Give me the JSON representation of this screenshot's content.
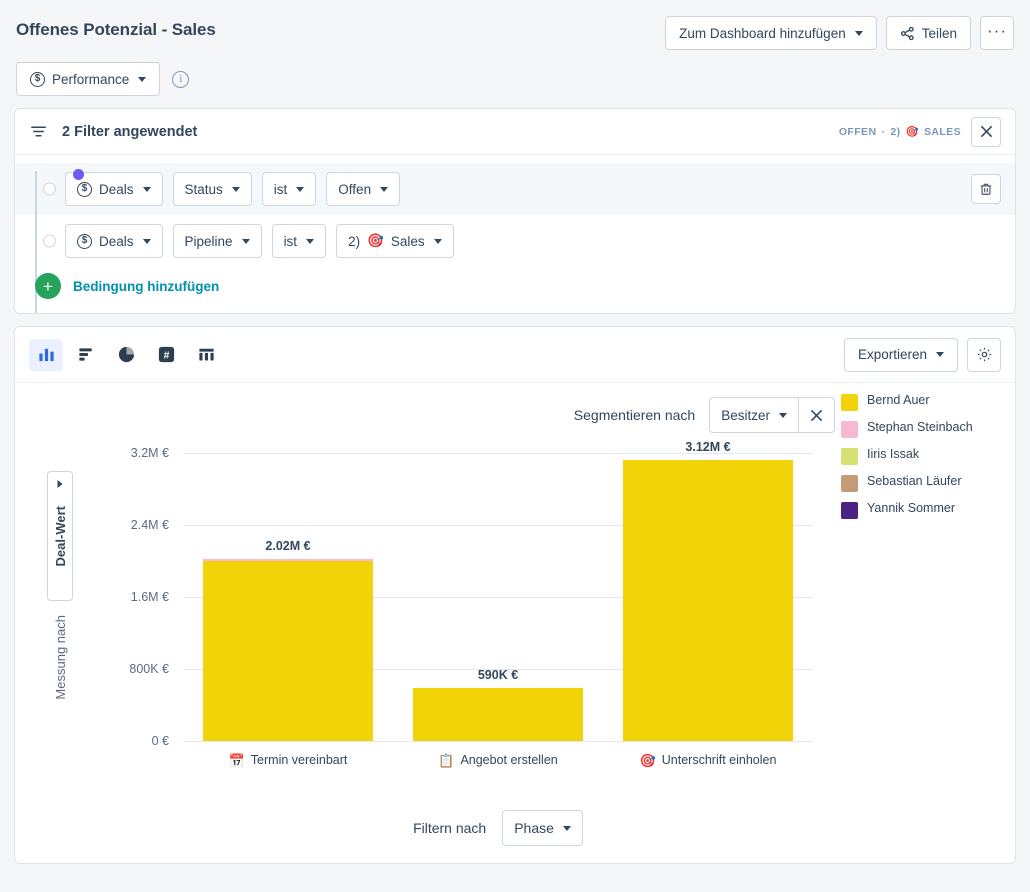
{
  "header": {
    "title": "Offenes Potenzial - Sales",
    "add_to_dashboard_label": "Zum Dashboard hinzufügen",
    "share_label": "Teilen",
    "more_label": "···"
  },
  "subheader": {
    "performance_label": "Performance",
    "currency_icon": "dollar-circle-icon",
    "info_icon": "info-icon"
  },
  "filters": {
    "title": "2 Filter angewendet",
    "applied_summary_prefix": "OFFEN",
    "applied_summary_separator": "·",
    "applied_summary_suffix": "2)",
    "applied_summary_target_icon": "🎯",
    "applied_summary_last": "SALES",
    "close_label": "✕",
    "rows": [
      {
        "object_label": "Deals",
        "property_label": "Status",
        "operator_label": "ist",
        "value_label": "Offen",
        "has_icon": true,
        "value_icon": ""
      },
      {
        "object_label": "Deals",
        "property_label": "Pipeline",
        "operator_label": "ist",
        "value_label": "2)  Sales",
        "has_icon": true,
        "value_icon": "🎯"
      }
    ],
    "add_condition_label": "Bedingung hinzufügen",
    "delete_icon": "trash-icon"
  },
  "chart_toolbar": {
    "types": [
      {
        "name": "vertical-bar-chart",
        "active": true
      },
      {
        "name": "horizontal-bar-chart",
        "active": false
      },
      {
        "name": "pie-chart",
        "active": false
      },
      {
        "name": "number-summary",
        "active": false
      },
      {
        "name": "table-view",
        "active": false
      }
    ],
    "export_label": "Exportieren",
    "settings_icon": "gear-icon"
  },
  "chart_controls": {
    "segment_by_label": "Segmentieren nach",
    "segment_by_value": "Besitzer",
    "segment_clear_label": "✕",
    "measure_axis_label": "Messung nach",
    "measure_value": "Deal-Wert",
    "filter_by_label": "Filtern nach",
    "filter_by_value": "Phase"
  },
  "chart_data": {
    "type": "bar",
    "title": "",
    "xlabel": "",
    "ylabel": "Deal-Wert",
    "categories": [
      "Termin vereinbart",
      "Angebot erstellen",
      "Unterschrift einholen"
    ],
    "category_icons": [
      "📅",
      "📋",
      "🎯"
    ],
    "values": [
      2020000,
      590000,
      3120000
    ],
    "value_labels": [
      "2.02M €",
      "590K €",
      "3.12M €"
    ],
    "ylim": [
      0,
      3400000
    ],
    "yticks": [
      0,
      800000,
      1600000,
      2400000,
      3200000
    ],
    "ytick_labels": [
      "0 €",
      "800K €",
      "1.6M €",
      "2.4M €",
      "3.2M €"
    ],
    "grid": true,
    "legend_position": "right",
    "stacked": true,
    "series": [
      {
        "name": "Bernd Auer",
        "color": "#F2D307",
        "values": [
          2008000,
          590000,
          3120000
        ]
      },
      {
        "name": "Stephan Steinbach",
        "color": "#F5B9D3",
        "values": [
          12000,
          0,
          0
        ]
      },
      {
        "name": "Iiris Issak",
        "color": "#D6E173",
        "values": [
          0,
          0,
          0
        ]
      },
      {
        "name": "Sebastian Läufer",
        "color": "#C59A78",
        "values": [
          0,
          0,
          0
        ]
      },
      {
        "name": "Yannik Sommer",
        "color": "#4A2382",
        "values": [
          0,
          0,
          0
        ]
      }
    ]
  },
  "legend": [
    {
      "label": "Bernd Auer",
      "color": "#F2D307"
    },
    {
      "label": "Stephan Steinbach",
      "color": "#F5B9D3"
    },
    {
      "label": "Iiris Issak",
      "color": "#D6E173"
    },
    {
      "label": "Sebastian Läufer",
      "color": "#C59A78"
    },
    {
      "label": "Yannik Sommer",
      "color": "#4A2382"
    }
  ]
}
